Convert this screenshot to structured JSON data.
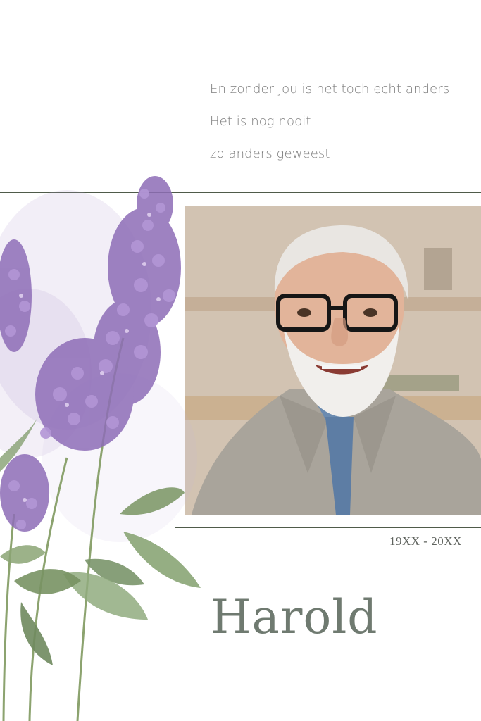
{
  "poem": {
    "lines": [
      "En zonder jou is het toch echt anders",
      "Het is nog nooit",
      "zo anders geweest"
    ]
  },
  "memorial": {
    "years": "19XX - 20XX",
    "name": "Harold"
  },
  "colors": {
    "text_gray": "#7d7d7d",
    "name_green_gray": "#6f7a70",
    "rule_green": "#4f5b4a",
    "lilac": "#9b7bbf",
    "leaf": "#7f9a6a"
  },
  "illustrations": {
    "flower_icon": "watercolor-lilac",
    "portrait_icon": "smiling-older-man-photo"
  }
}
